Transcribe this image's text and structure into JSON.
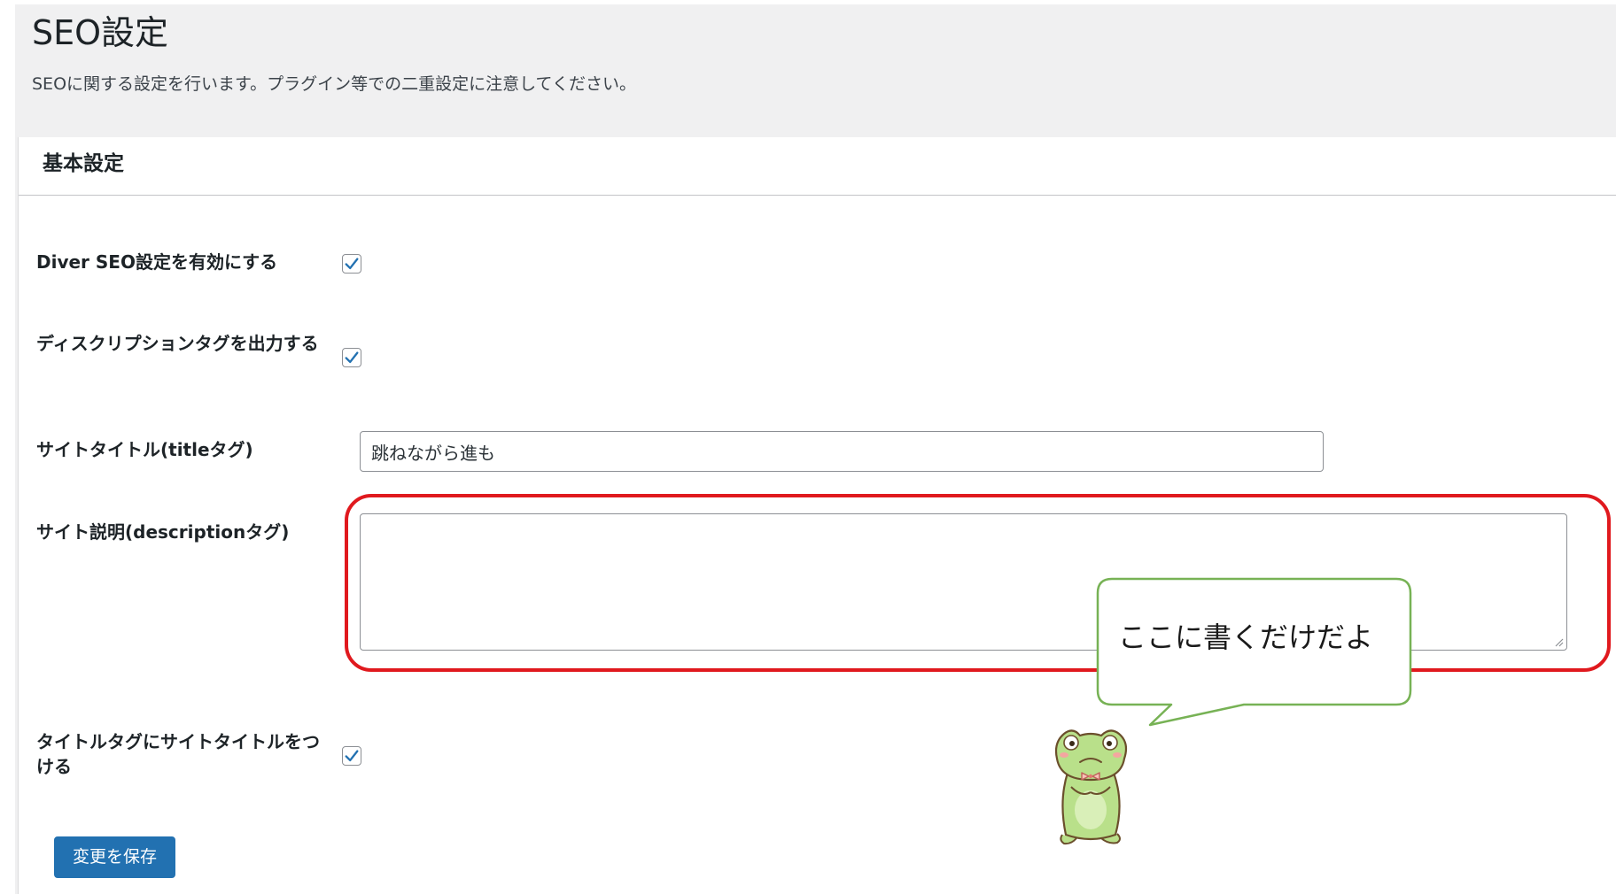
{
  "page": {
    "title": "SEO設定",
    "description": "SEOに関する設定を行います。プラグイン等での二重設定に注意してください。"
  },
  "panel": {
    "title": "基本設定"
  },
  "fields": {
    "enable_seo": {
      "label": "Diver SEO設定を有効にする",
      "checked": true
    },
    "output_description": {
      "label": "ディスクリプションタグを出力する",
      "checked": true
    },
    "site_title": {
      "label": "サイトタイトル(titleタグ)",
      "value": "跳ねながら進も"
    },
    "site_description": {
      "label": "サイト説明(descriptionタグ)",
      "value": ""
    },
    "append_site_title": {
      "label": "タイトルタグにサイトタイトルをつける",
      "checked": true
    }
  },
  "actions": {
    "save_label": "変更を保存"
  },
  "annotation": {
    "bubble_text": "ここに書くだけだよ",
    "highlight_color": "#e0191e",
    "bubble_border_color": "#77b255"
  },
  "colors": {
    "primary_button": "#2271b1",
    "check_mark": "#2271b1",
    "admin_background": "#f0f0f1"
  },
  "icons": {
    "checkbox": "check-icon",
    "textarea_resize": "resize-grip-icon",
    "mascot": "frog-mascot-icon"
  }
}
